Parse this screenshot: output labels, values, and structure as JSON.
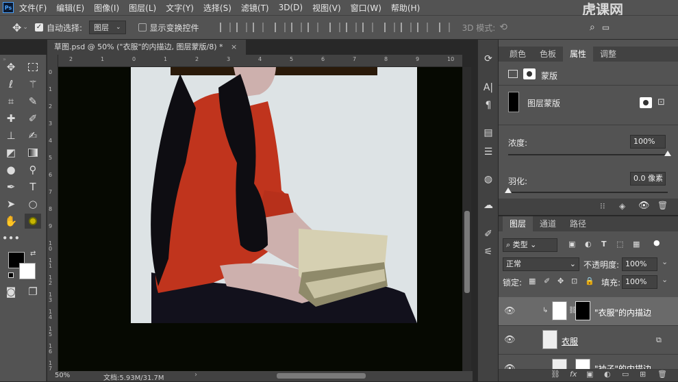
{
  "app": {
    "logo": "Ps"
  },
  "menu": [
    "文件(F)",
    "编辑(E)",
    "图像(I)",
    "图层(L)",
    "文字(Y)",
    "选择(S)",
    "滤镜(T)",
    "3D(D)",
    "视图(V)",
    "窗口(W)",
    "帮助(H)"
  ],
  "options": {
    "auto_select_label": "自动选择:",
    "auto_select_value": "图层",
    "show_transform_label": "显示变换控件",
    "mode_3d_label": "3D 模式:"
  },
  "watermark": "虎课网",
  "document": {
    "tab_title": "草图.psd @ 50% (\"衣服\"的内描边, 图层蒙版/8) *",
    "close_glyph": "×",
    "zoom": "50%",
    "doc_info": "文档:5.93M/31.7M"
  },
  "ruler": {
    "h_ticks": [
      "2",
      "1",
      "0",
      "1",
      "2",
      "3",
      "4",
      "5",
      "6",
      "7",
      "8",
      "9",
      "10"
    ],
    "v_ticks": [
      "0",
      "1",
      "2",
      "3",
      "4",
      "5",
      "6",
      "7",
      "8",
      "9",
      "1 0",
      "1 1",
      "1 2",
      "1 3",
      "1 4",
      "1 5",
      "1 6",
      "1 7"
    ]
  },
  "properties": {
    "tabs": [
      "颜色",
      "色板",
      "属性",
      "调整"
    ],
    "active_tab": "属性",
    "mask_label": "蒙版",
    "layer_mask_label": "图层蒙版",
    "density_label": "浓度:",
    "density_value": "100%",
    "density_level": 1.0,
    "feather_label": "羽化:",
    "feather_value": "0.0 像素",
    "feather_level": 0.0
  },
  "layers": {
    "tabs": [
      "图层",
      "通道",
      "路径"
    ],
    "active_tab": "图层",
    "filter_label": "类型",
    "blend_mode": "正常",
    "opacity_label": "不透明度:",
    "opacity_value": "100%",
    "lock_label": "锁定:",
    "fill_label": "填充:",
    "fill_value": "100%",
    "rows": [
      {
        "name": "\"衣服\"的内描边",
        "selected": true
      },
      {
        "name": "衣服",
        "selected": false
      },
      {
        "name": "\"袖子\"的内描边",
        "selected": false
      }
    ],
    "footer_fx": "fx"
  },
  "icons": [
    "move-icon",
    "marquee-icon",
    "lasso-icon",
    "magic-wand-icon",
    "crop-icon",
    "eyedropper-icon",
    "healing-icon",
    "brush-icon",
    "stamp-icon",
    "history-brush-icon",
    "eraser-icon",
    "gradient-icon",
    "blur-icon",
    "dodge-icon",
    "pen-icon",
    "type-icon",
    "path-select-icon",
    "ellipse-icon",
    "hand-icon",
    "zoom-icon",
    "more-icon"
  ],
  "colors": {
    "foreground": "#000000",
    "background": "#ffffff",
    "shirt": "#c0341d",
    "hair": "#0e0d12",
    "skin": "#cdb0ad",
    "book": "#d6d0b2",
    "canvas_bg": "#dde3e5"
  }
}
